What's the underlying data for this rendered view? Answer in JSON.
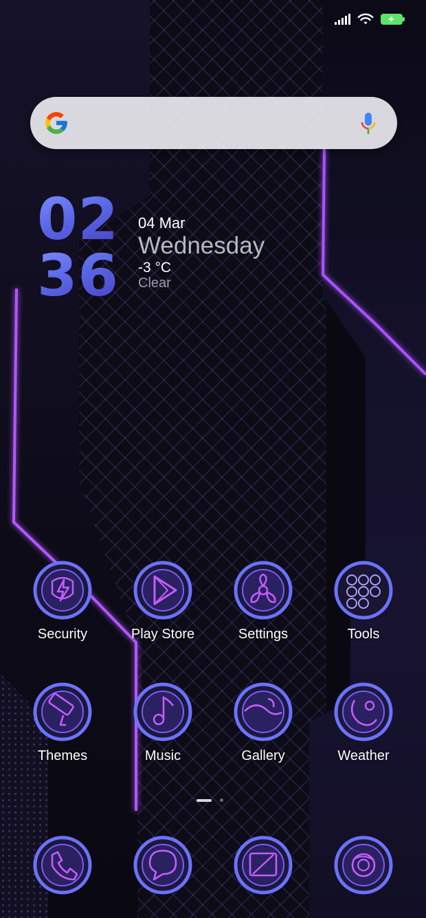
{
  "status_bar": {
    "signal_icon": "signal-icon",
    "wifi_icon": "wifi-icon",
    "battery_icon": "battery-charging-icon",
    "battery_color": "#5be36a"
  },
  "search": {
    "logo_icon": "google-logo-icon",
    "mic_icon": "microphone-icon"
  },
  "clock": {
    "hours": "02",
    "minutes": "36",
    "date": "04 Mar",
    "weekday": "Wednesday",
    "temperature": "-3 °C",
    "condition": "Clear"
  },
  "apps_row1": [
    {
      "label": "Security",
      "icon": "lightning-shield-icon"
    },
    {
      "label": "Play Store",
      "icon": "play-triangle-icon"
    },
    {
      "label": "Settings",
      "icon": "fan-gear-icon"
    },
    {
      "label": "Tools",
      "icon": "folder-grid-icon"
    }
  ],
  "apps_row2": [
    {
      "label": "Themes",
      "icon": "paint-roller-icon"
    },
    {
      "label": "Music",
      "icon": "music-note-icon"
    },
    {
      "label": "Gallery",
      "icon": "image-wave-icon"
    },
    {
      "label": "Weather",
      "icon": "moon-cloud-icon"
    }
  ],
  "dock": [
    {
      "icon": "phone-icon"
    },
    {
      "icon": "chat-bubble-icon"
    },
    {
      "icon": "browser-window-icon"
    },
    {
      "icon": "camera-lens-icon"
    }
  ],
  "page_indicator": {
    "pages": 2,
    "current": 1
  },
  "theme": {
    "accent": "#6b72ff",
    "neon": "#b44cff"
  }
}
